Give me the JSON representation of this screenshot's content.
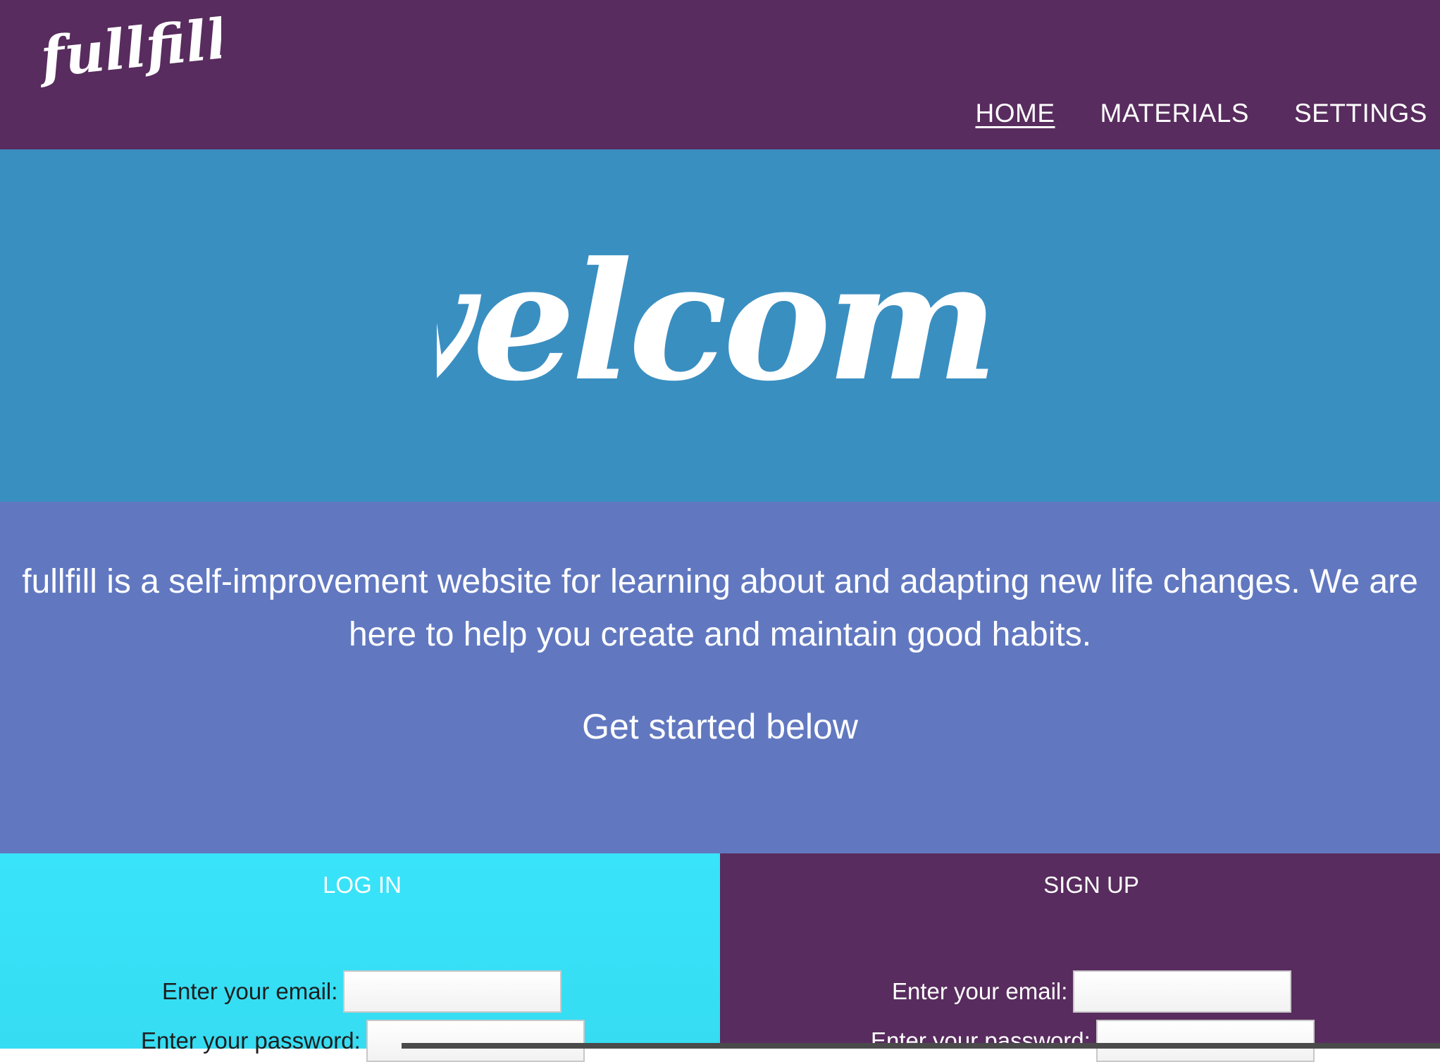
{
  "header": {
    "logo_text": "fullfill.",
    "nav": [
      {
        "label": "HOME",
        "active": true
      },
      {
        "label": "MATERIALS",
        "active": false
      },
      {
        "label": "SETTINGS",
        "active": false
      }
    ]
  },
  "hero": {
    "welcome_text": "welcome"
  },
  "about": {
    "description": "fullfill is a self-improvement website for learning about and adapting new life changes. We are here to help you create and maintain good habits.",
    "cta": "Get started below"
  },
  "login": {
    "title": "LOG IN",
    "email_label": "Enter your email:",
    "password_label": "Enter your password:"
  },
  "signup": {
    "title": "SIGN UP",
    "email_label": "Enter your email:",
    "password_label": "Enter your password:"
  },
  "colors": {
    "header_bg": "#582c5e",
    "hero_bg": "#3a8fc1",
    "about_bg": "#6178c0",
    "login_bg": "#38e4fa",
    "signup_bg": "#582c5e"
  }
}
